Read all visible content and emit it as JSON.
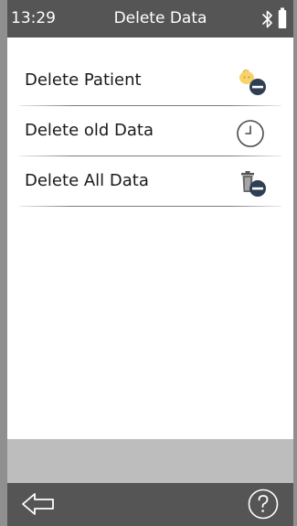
{
  "status_bar": {
    "time": "13:29",
    "title": "Delete Data",
    "icons": [
      "bluetooth-icon",
      "battery-icon"
    ]
  },
  "menu": {
    "items": [
      {
        "label": "Delete Patient",
        "icon": "patient-remove-icon"
      },
      {
        "label": "Delete old Data",
        "icon": "clock-icon"
      },
      {
        "label": "Delete All Data",
        "icon": "trash-remove-icon"
      }
    ]
  },
  "nav": {
    "icons": [
      "back-arrow-icon",
      "help-icon"
    ]
  },
  "colors": {
    "status_bar_bg": "#555555",
    "nav_bar_bg": "#555555",
    "bottom_strip_bg": "#bdbdbd",
    "frame_bg": "#8f8f8f",
    "remove_badge": "#2e3f53",
    "patient_icon": "#f6d36b"
  }
}
